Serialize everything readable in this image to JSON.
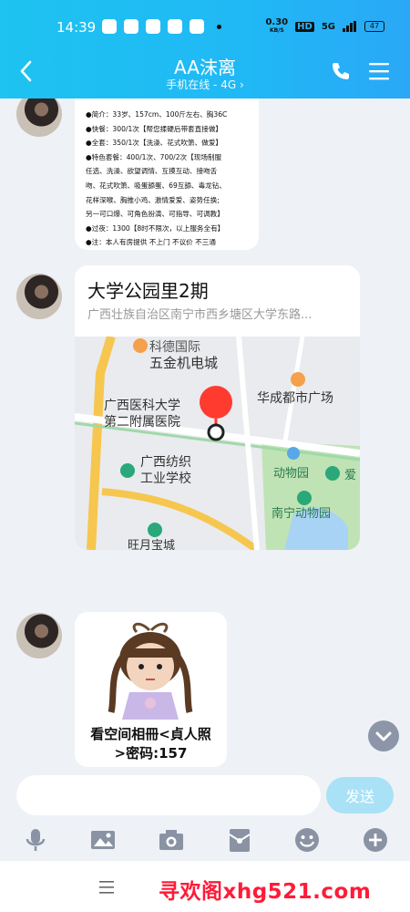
{
  "status_bar": {
    "time": "14:39",
    "net_speed_top": "0.30",
    "net_speed_bottom": "KB/S",
    "hd": "HD",
    "signal": "5G",
    "battery": "47"
  },
  "header": {
    "title": "AA沫离",
    "subtitle": "手机在线 - 4G ›"
  },
  "messages": {
    "text_lines": [
      "●简介：33岁、157cm、100斤左右、胸36C",
      "●快餐：300/1次【帮您揉硬后带套直接做】",
      "●全套：350/1次【洗澡、花式吹箫、做爱】",
      "●特色套餐：400/1次、700/2次【现场制服",
      "任选、洗澡、欲望调情、互摸互动、接吻舌",
      "吻、花式吹箫、吸蛋舔蛋、69互舔、毒龙钻、",
      "花样深喉、胸推小鸡、激情爱爱、姿势任换;",
      "另一可口爆、可角色扮演、可指导、可调教】",
      "●过夜：1300【8时不限次，以上服务全有】",
      "●注：本人有房提供  不上门  不议价  不三通"
    ],
    "location": {
      "title": "大学公园里2期",
      "address": "广西壮族自治区南宁市西乡塘区大学东路...",
      "map_labels": [
        "科德国际",
        "五金机电城",
        "广西医科大学",
        "第二附属医院",
        "华成都市广场",
        "广西纺织",
        "工业学校",
        "动物园",
        "南宁动物园",
        "爱",
        "旺月宝城"
      ]
    },
    "sticker": {
      "caption_line1": "看空间相冊<貞人照",
      "caption_line2": ">密码:157"
    }
  },
  "input": {
    "value": "",
    "send_label": "发送"
  },
  "toolbar": {
    "icons": [
      "microphone-icon",
      "image-icon",
      "camera-icon",
      "red-packet-icon",
      "emoji-icon",
      "plus-icon"
    ]
  },
  "bottom_nav": {
    "watermark": "寻欢阁xhg521.com"
  },
  "colors": {
    "header": "#20b8f5",
    "send_button": "#a9e1f7",
    "watermark": "#ff1b38",
    "map_pin": "#ff3b30"
  }
}
